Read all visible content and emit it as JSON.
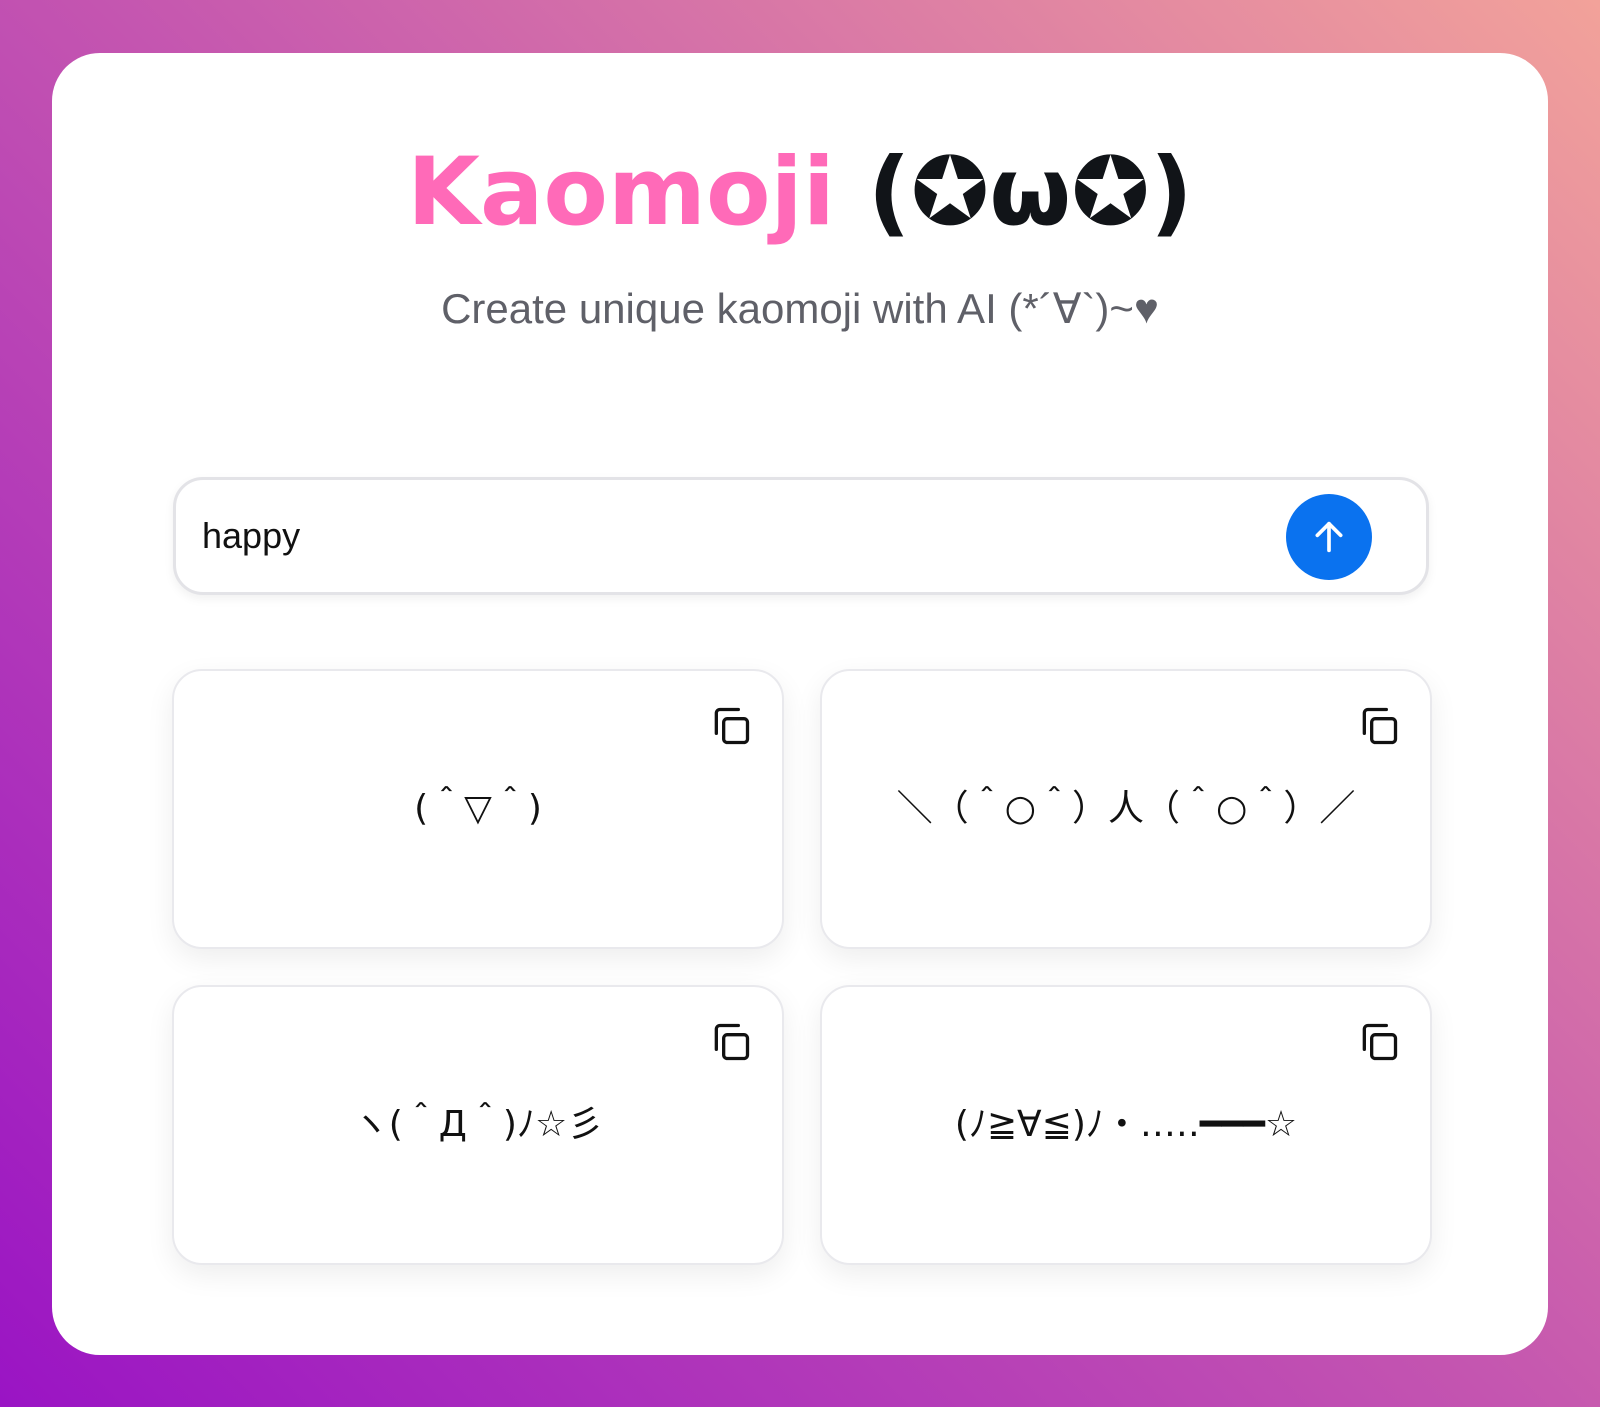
{
  "header": {
    "title_word": "Kaomoji",
    "title_face": "(✪ω✪)",
    "subtitle": "Create unique kaomoji with AI (*´∀`)~♥"
  },
  "search": {
    "value": "happy",
    "submit_icon": "arrow-up-icon"
  },
  "results": [
    {
      "kaomoji": "(＾▽＾)",
      "copy_icon": "copy-icon"
    },
    {
      "kaomoji": "＼（＾○＾）人（＾○＾）／",
      "copy_icon": "copy-icon"
    },
    {
      "kaomoji": "ヽ(＾Д＾)ﾉ☆彡",
      "copy_icon": "copy-icon"
    },
    {
      "kaomoji": "(ﾉ≧∀≦)ﾉ・‥…━━━☆",
      "copy_icon": "copy-icon"
    }
  ],
  "colors": {
    "title_accent": "#ff6ab8",
    "button_blue": "#0a72ef",
    "bg_gradient_start": "#9a14c4",
    "bg_gradient_end": "#f2a29a"
  }
}
